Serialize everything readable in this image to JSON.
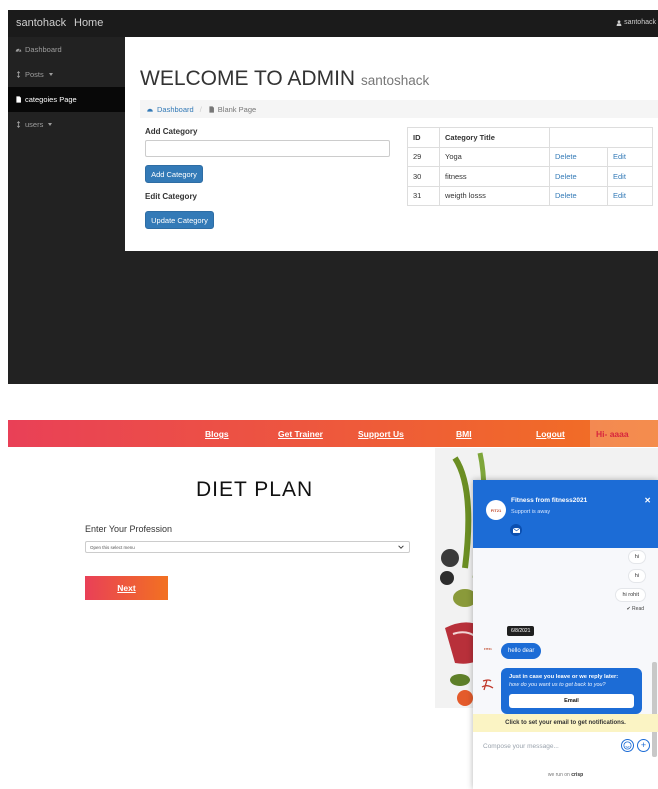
{
  "admin": {
    "brand": "santohack",
    "home": "Home",
    "user": "santohack",
    "sidebar": [
      {
        "label": "Dashboard",
        "icon": "dashboard-icon",
        "caret": false,
        "active": false
      },
      {
        "label": "Posts",
        "icon": "arrows-icon",
        "caret": true,
        "active": false
      },
      {
        "label": "categoies Page",
        "icon": "file-icon",
        "caret": false,
        "active": true
      },
      {
        "label": "users",
        "icon": "arrows-icon",
        "caret": true,
        "active": false
      }
    ],
    "title": "WELCOME TO ADMIN",
    "title_small": "santoshack",
    "breadcrumb": {
      "link": "Dashboard",
      "current": "Blank Page"
    },
    "add_label": "Add Category",
    "add_button": "Add Category",
    "edit_label": "Edit Category",
    "update_button": "Update Category",
    "table": {
      "headers": [
        "ID",
        "Category Title",
        ""
      ],
      "rows": [
        {
          "id": "29",
          "title": "Yoga",
          "delete": "Delete",
          "edit": "Edit"
        },
        {
          "id": "30",
          "title": "fitness",
          "delete": "Delete",
          "edit": "Edit"
        },
        {
          "id": "31",
          "title": "weigth losss",
          "delete": "Delete",
          "edit": "Edit"
        }
      ]
    },
    "colors": {
      "nav": "#1b1b1b",
      "link": "#337ab7"
    }
  },
  "diet": {
    "nav": [
      "Blogs",
      "Get Trainer",
      "Support Us",
      "BMI",
      "Logout"
    ],
    "greeting": "Hi- aaaa",
    "title": "DIET PLAN",
    "profession_label": "Enter Your Profession",
    "select_placeholder": "Open this select menu",
    "next": "Next",
    "colors": {
      "gradient_start": "#e94057",
      "gradient_end": "#f27121"
    }
  },
  "chat": {
    "title": "Fitness from fitness2021",
    "status": "Support is away",
    "avatar_text": "FIT21",
    "messages_right": [
      "hi",
      "hi",
      "hi rohit"
    ],
    "read": "Read",
    "date": "6/8/2021",
    "message_left": "hello dear",
    "card_title": "Just in case you leave or we reply later:",
    "card_sub": "how do you want us to get back to you?",
    "email_button": "Email",
    "notify": "Click to set your email to get notifications.",
    "compose_placeholder": "Compose your message...",
    "powered_prefix": "we run on",
    "powered_brand": "crisp",
    "accent": "#1c6cd6"
  }
}
